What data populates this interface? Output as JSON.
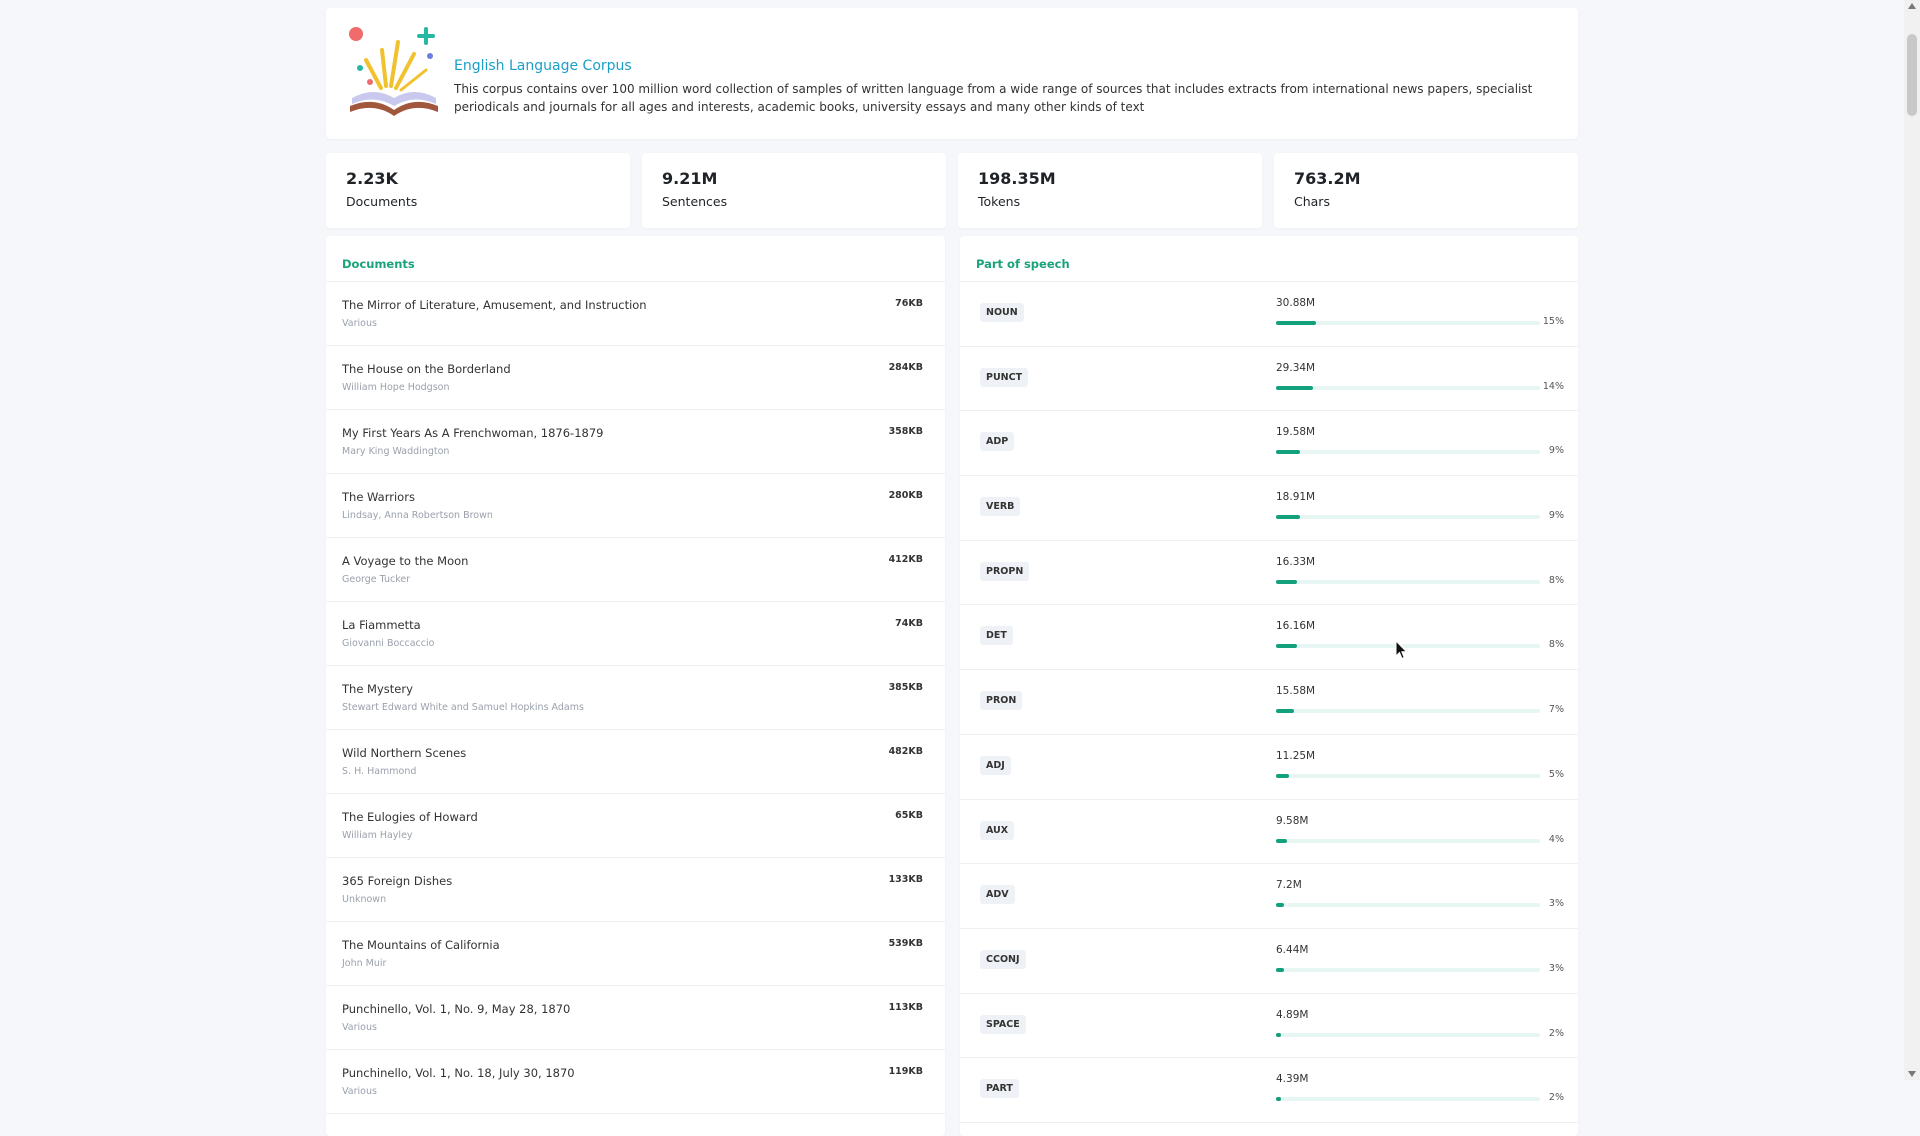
{
  "corpus": {
    "title": "English Language Corpus",
    "description": "This corpus contains over 100 million word collection of samples of written language from a wide range of sources that includes extracts from international news papers, specialist periodicals and journals for all ages and interests, academic books, university essays and many other kinds of text"
  },
  "stats": [
    {
      "value": "2.23K",
      "label": "Documents"
    },
    {
      "value": "9.21M",
      "label": "Sentences"
    },
    {
      "value": "198.35M",
      "label": "Tokens"
    },
    {
      "value": "763.2M",
      "label": "Chars"
    }
  ],
  "documents_panel": {
    "title": "Documents",
    "items": [
      {
        "title": "The Mirror of Literature, Amusement, and Instruction",
        "author": "Various",
        "size": "76KB"
      },
      {
        "title": "The House on the Borderland",
        "author": "William Hope Hodgson",
        "size": "284KB"
      },
      {
        "title": "My First Years As A Frenchwoman, 1876-1879",
        "author": "Mary King Waddington",
        "size": "358KB"
      },
      {
        "title": "The Warriors",
        "author": "Lindsay, Anna Robertson Brown",
        "size": "280KB"
      },
      {
        "title": "A Voyage to the Moon",
        "author": "George Tucker",
        "size": "412KB"
      },
      {
        "title": "La Fiammetta",
        "author": "Giovanni Boccaccio",
        "size": "74KB"
      },
      {
        "title": "The Mystery",
        "author": "Stewart Edward White and Samuel Hopkins Adams",
        "size": "385KB"
      },
      {
        "title": "Wild Northern Scenes",
        "author": "S. H. Hammond",
        "size": "482KB"
      },
      {
        "title": "The Eulogies of Howard",
        "author": "William Hayley",
        "size": "65KB"
      },
      {
        "title": "365 Foreign Dishes",
        "author": "Unknown",
        "size": "133KB"
      },
      {
        "title": "The Mountains of California",
        "author": "John Muir",
        "size": "539KB"
      },
      {
        "title": "Punchinello, Vol. 1, No. 9, May 28, 1870",
        "author": "Various",
        "size": "113KB"
      },
      {
        "title": "Punchinello, Vol. 1, No. 18, July 30, 1870",
        "author": "Various",
        "size": "119KB"
      }
    ]
  },
  "pos_panel": {
    "title": "Part of speech",
    "items": [
      {
        "tag": "NOUN",
        "count": "30.88M",
        "pct": "15%",
        "fraction": 0.15
      },
      {
        "tag": "PUNCT",
        "count": "29.34M",
        "pct": "14%",
        "fraction": 0.14
      },
      {
        "tag": "ADP",
        "count": "19.58M",
        "pct": "9%",
        "fraction": 0.09
      },
      {
        "tag": "VERB",
        "count": "18.91M",
        "pct": "9%",
        "fraction": 0.09
      },
      {
        "tag": "PROPN",
        "count": "16.33M",
        "pct": "8%",
        "fraction": 0.08
      },
      {
        "tag": "DET",
        "count": "16.16M",
        "pct": "8%",
        "fraction": 0.08
      },
      {
        "tag": "PRON",
        "count": "15.58M",
        "pct": "7%",
        "fraction": 0.07
      },
      {
        "tag": "ADJ",
        "count": "11.25M",
        "pct": "5%",
        "fraction": 0.05
      },
      {
        "tag": "AUX",
        "count": "9.58M",
        "pct": "4%",
        "fraction": 0.04
      },
      {
        "tag": "ADV",
        "count": "7.2M",
        "pct": "3%",
        "fraction": 0.03
      },
      {
        "tag": "CCONJ",
        "count": "6.44M",
        "pct": "3%",
        "fraction": 0.03
      },
      {
        "tag": "SPACE",
        "count": "4.89M",
        "pct": "2%",
        "fraction": 0.02
      },
      {
        "tag": "PART",
        "count": "4.39M",
        "pct": "2%",
        "fraction": 0.02
      }
    ]
  },
  "colors": {
    "accent_blue": "#1aa0c7",
    "accent_green": "#12a17c",
    "bar_track": "#e7f6f2",
    "background": "#f5f7fb"
  },
  "icons": {
    "logo": "open-book-celebration-icon",
    "cursor": "mouse-pointer-icon"
  }
}
